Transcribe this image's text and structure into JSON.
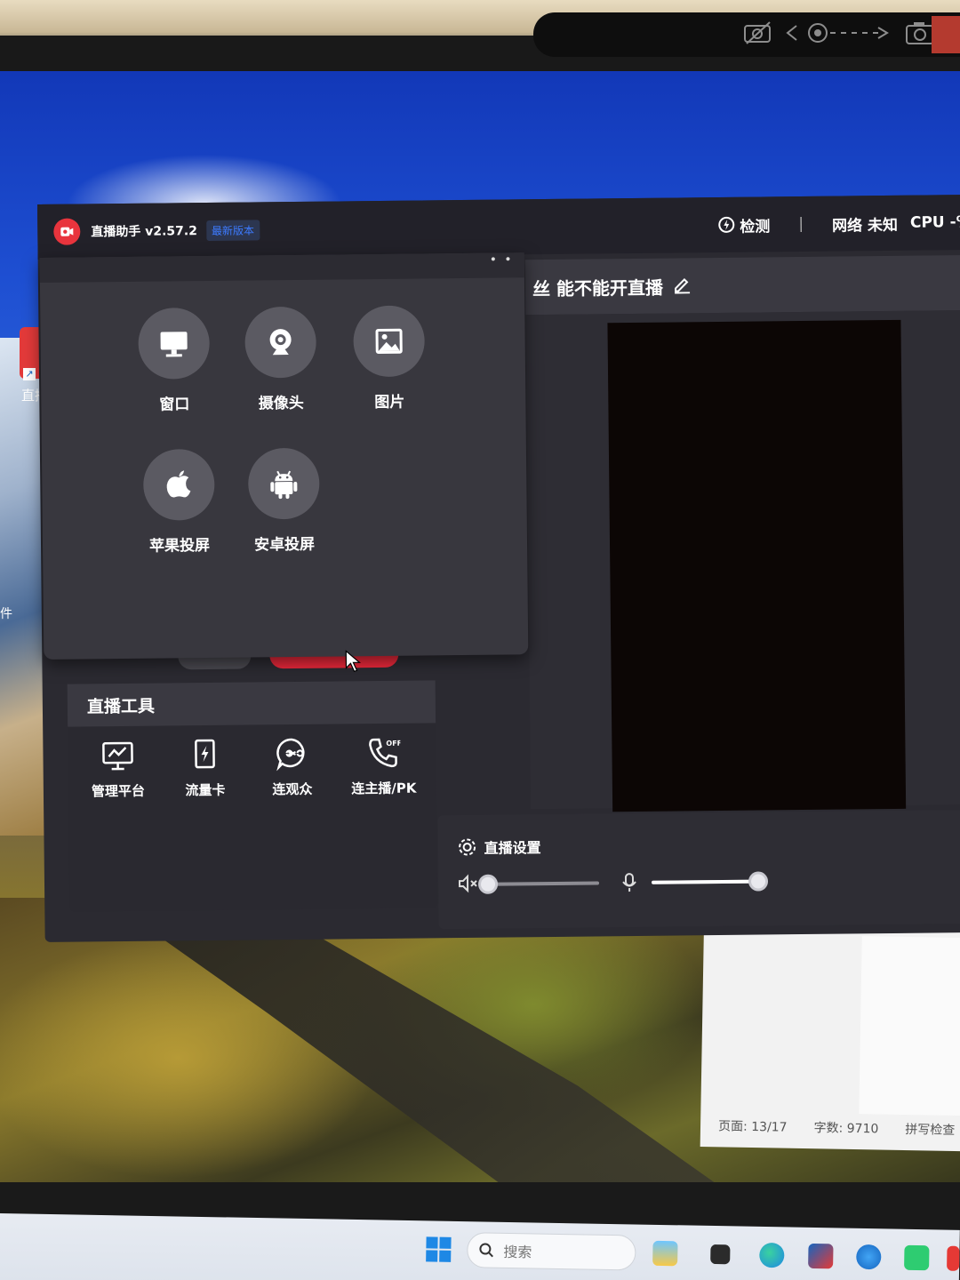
{
  "app": {
    "name": "直播助手 v2.57.2",
    "version_badge": "最新版本",
    "detect_label": "检测",
    "network_label": "网络 未知",
    "cpu_label": "CPU -%"
  },
  "stream": {
    "title": "丝 能不能开直播"
  },
  "popup": {
    "sources": [
      {
        "label": "窗口",
        "icon": "monitor-icon"
      },
      {
        "label": "摄像头",
        "icon": "webcam-icon"
      },
      {
        "label": "图片",
        "icon": "image-icon"
      },
      {
        "label": "苹果投屏",
        "icon": "apple-icon"
      },
      {
        "label": "安卓投屏",
        "icon": "android-icon"
      }
    ]
  },
  "tools": {
    "header": "直播工具",
    "items": [
      {
        "label": "管理平台",
        "icon": "dashboard-icon"
      },
      {
        "label": "流量卡",
        "icon": "flash-card-icon"
      },
      {
        "label": "连观众",
        "icon": "link-chat-icon"
      },
      {
        "label": "连主播/PK",
        "icon": "phone-off-icon"
      }
    ]
  },
  "settings": {
    "title": "直播设置",
    "speaker_level": 0.0,
    "mic_level": 1.0
  },
  "desktop": {
    "icon_label": "直播",
    "left_label": "件"
  },
  "doc": {
    "page": "页面: 13/17",
    "words": "字数: 9710",
    "spell": "拼写检查"
  },
  "taskbar": {
    "search_placeholder": "搜索"
  },
  "colors": {
    "accent_red": "#e8283a",
    "version_blue": "#3d7bff",
    "panel_bg": "#2b2a31"
  }
}
